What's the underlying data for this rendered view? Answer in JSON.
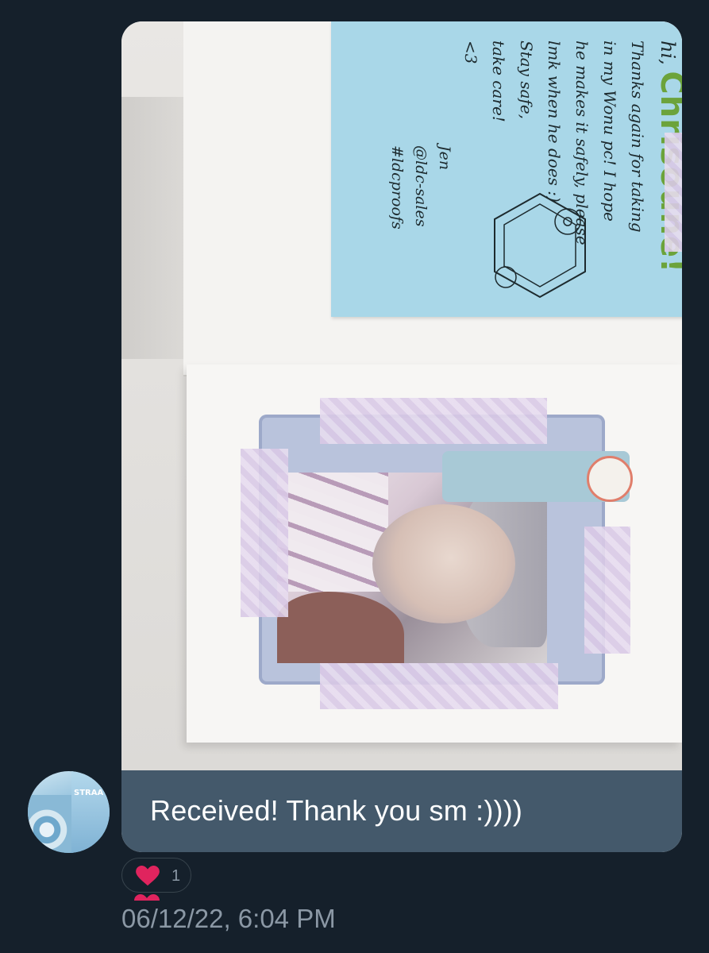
{
  "message": {
    "image": {
      "alt_content": "card",
      "note": {
        "greeting": "hi,",
        "name": "Chrisoune!",
        "lines": [
          "Thanks again for taking",
          "in my Wonu pc! I hope",
          "he makes it safely, please",
          "lmk when he does :)",
          "Stay safe,",
          "take care!",
          "<3"
        ],
        "signature_lines": [
          "Jen",
          "@ldc-sales",
          "#ldcproofs"
        ]
      }
    },
    "text": "Received! Thank you sm :))))",
    "reaction": {
      "icon": "heart-icon",
      "count": "1",
      "color": "#e0245e"
    },
    "timestamp": "06/12/22, 6:04 PM"
  },
  "avatar": {
    "icon": "avatar",
    "label": "STRAA"
  },
  "colors": {
    "background": "#15202b",
    "bubble": "#44596b",
    "muted_text": "#8b98a5",
    "note_blue": "#a9d7e8",
    "name_green": "#6ca33b"
  }
}
